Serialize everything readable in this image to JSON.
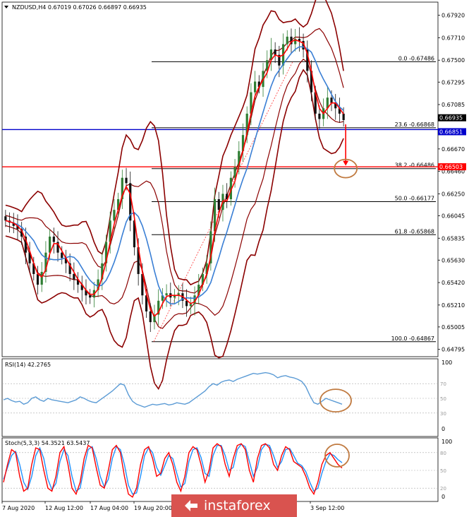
{
  "colors": {
    "bollinger": "#8b0000",
    "ma_fast": "#ff0000",
    "ma_slow": "#3a7fd5",
    "candle_up": "#2e7d32",
    "candle_down": "#111111",
    "level_blue": "#0000cc",
    "level_red": "#ff0000",
    "fib": "#000000",
    "trend_dotted": "#ff3333",
    "rsi_line": "#5b9bd5",
    "stoch_main": "#ff0000",
    "stoch_signal": "#1e90ff",
    "annotation": "#c07a40",
    "watermark_bg": "#d9534f"
  },
  "chart_data": [
    {
      "type": "candlestick",
      "title": "NZDUSD,H4  0.67019 0.67026 0.66897 0.66935",
      "symbol": "NZDUSD,H4",
      "ohlc_header": [
        "0.67019",
        "0.67026",
        "0.66897",
        "0.66935"
      ],
      "ylim": [
        0.6474,
        0.6803
      ],
      "y_ticks": [
        "0.67920",
        "0.67710",
        "0.67500",
        "0.67295",
        "0.67085",
        "0.66670",
        "0.66460",
        "0.66250",
        "0.66045",
        "0.65835",
        "0.65630",
        "0.65420",
        "0.65210",
        "0.65005",
        "0.64795"
      ],
      "x_ticks": [
        "7 Aug 2020",
        "12 Aug 12:00",
        "17 Aug 04:00",
        "19 Aug 20:00",
        "3 Sep 12:00"
      ],
      "closes": [
        0.66,
        0.6598,
        0.6595,
        0.6592,
        0.6585,
        0.657,
        0.656,
        0.655,
        0.654,
        0.6552,
        0.657,
        0.6585,
        0.658,
        0.657,
        0.6565,
        0.656,
        0.655,
        0.6545,
        0.654,
        0.6535,
        0.653,
        0.6528,
        0.6535,
        0.6545,
        0.656,
        0.658,
        0.66,
        0.661,
        0.662,
        0.664,
        0.6635,
        0.66,
        0.6575,
        0.655,
        0.653,
        0.6515,
        0.6505,
        0.6512,
        0.6525,
        0.653,
        0.6532,
        0.6528,
        0.653,
        0.6532,
        0.6525,
        0.652,
        0.6522,
        0.653,
        0.654,
        0.655,
        0.656,
        0.659,
        0.662,
        0.661,
        0.6625,
        0.662,
        0.664,
        0.665,
        0.6665,
        0.668,
        0.67,
        0.672,
        0.673,
        0.6725,
        0.674,
        0.675,
        0.676,
        0.6755,
        0.6745,
        0.6765,
        0.6772,
        0.6765,
        0.677,
        0.6768,
        0.676,
        0.674,
        0.672,
        0.67,
        0.6695,
        0.6705,
        0.6715,
        0.671,
        0.6705,
        0.67,
        0.6694
      ],
      "fib_levels": [
        {
          "label": "0.0 -0.67486",
          "value": 0.67486
        },
        {
          "label": "23.6 -0.66868",
          "value": 0.66868
        },
        {
          "label": "38.2 -0.66486",
          "value": 0.66486
        },
        {
          "label": "50.0 -0.66177",
          "value": 0.66177
        },
        {
          "label": "61.8 -0.65868",
          "value": 0.65868
        },
        {
          "label": "100.0 -0.64867",
          "value": 0.64867
        }
      ],
      "price_tags": [
        {
          "label": "0.66935",
          "value": 0.66935,
          "color": "#000000"
        },
        {
          "label": "0.66851",
          "value": 0.66851,
          "color": "#0000cc"
        },
        {
          "label": "0.66503",
          "value": 0.66503,
          "color": "#ff0000"
        }
      ]
    },
    {
      "type": "line",
      "title": "RSI(14) 42.2765",
      "indicator": "RSI(14)",
      "value": "42.2765",
      "ylim": [
        0,
        100
      ],
      "y_ticks": [
        "100",
        "0"
      ],
      "levels": [
        "70",
        "50",
        "30"
      ],
      "values": [
        48,
        50,
        47,
        45,
        46,
        42,
        44,
        50,
        52,
        48,
        46,
        50,
        48,
        47,
        46,
        45,
        44,
        46,
        48,
        52,
        50,
        47,
        45,
        44,
        48,
        52,
        56,
        60,
        65,
        70,
        68,
        55,
        46,
        42,
        40,
        38,
        40,
        42,
        41,
        42,
        43,
        41,
        42,
        44,
        43,
        42,
        44,
        48,
        52,
        56,
        60,
        66,
        70,
        68,
        72,
        74,
        75,
        73,
        76,
        78,
        80,
        82,
        84,
        83,
        84,
        85,
        84,
        82,
        78,
        80,
        81,
        79,
        78,
        76,
        73,
        66,
        54,
        44,
        42,
        46,
        50,
        48,
        46,
        44,
        42
      ]
    },
    {
      "type": "line",
      "title": "Stoch(5,3,3) 54.3521 63.5437",
      "indicator": "Stoch(5,3,3)",
      "values_header": [
        "54.3521",
        "63.5437"
      ],
      "ylim": [
        0,
        100
      ],
      "y_ticks": [
        "100",
        "0"
      ],
      "levels": [
        "80",
        "50",
        "20"
      ],
      "main": [
        30,
        60,
        85,
        80,
        40,
        15,
        20,
        60,
        88,
        85,
        50,
        20,
        15,
        40,
        80,
        90,
        60,
        20,
        10,
        30,
        70,
        92,
        88,
        55,
        25,
        20,
        50,
        85,
        92,
        80,
        40,
        10,
        5,
        20,
        60,
        85,
        90,
        70,
        40,
        45,
        70,
        80,
        60,
        30,
        15,
        40,
        80,
        90,
        85,
        60,
        30,
        50,
        88,
        95,
        90,
        60,
        40,
        70,
        92,
        95,
        85,
        50,
        30,
        70,
        92,
        95,
        88,
        60,
        50,
        75,
        90,
        85,
        65,
        60,
        55,
        40,
        20,
        10,
        30,
        60,
        75,
        80,
        70,
        60,
        54
      ],
      "signal": [
        35,
        55,
        75,
        82,
        60,
        30,
        18,
        40,
        75,
        88,
        70,
        35,
        18,
        28,
        65,
        85,
        75,
        40,
        15,
        20,
        55,
        85,
        90,
        70,
        40,
        22,
        35,
        70,
        90,
        85,
        60,
        25,
        10,
        12,
        40,
        75,
        88,
        80,
        55,
        42,
        58,
        75,
        70,
        45,
        22,
        28,
        65,
        85,
        88,
        72,
        45,
        40,
        75,
        92,
        92,
        75,
        50,
        55,
        85,
        94,
        90,
        65,
        40,
        55,
        85,
        94,
        92,
        75,
        55,
        65,
        85,
        87,
        75,
        62,
        58,
        48,
        30,
        15,
        20,
        45,
        65,
        78,
        75,
        68,
        63
      ]
    }
  ],
  "watermark": {
    "text": "instaforex"
  }
}
